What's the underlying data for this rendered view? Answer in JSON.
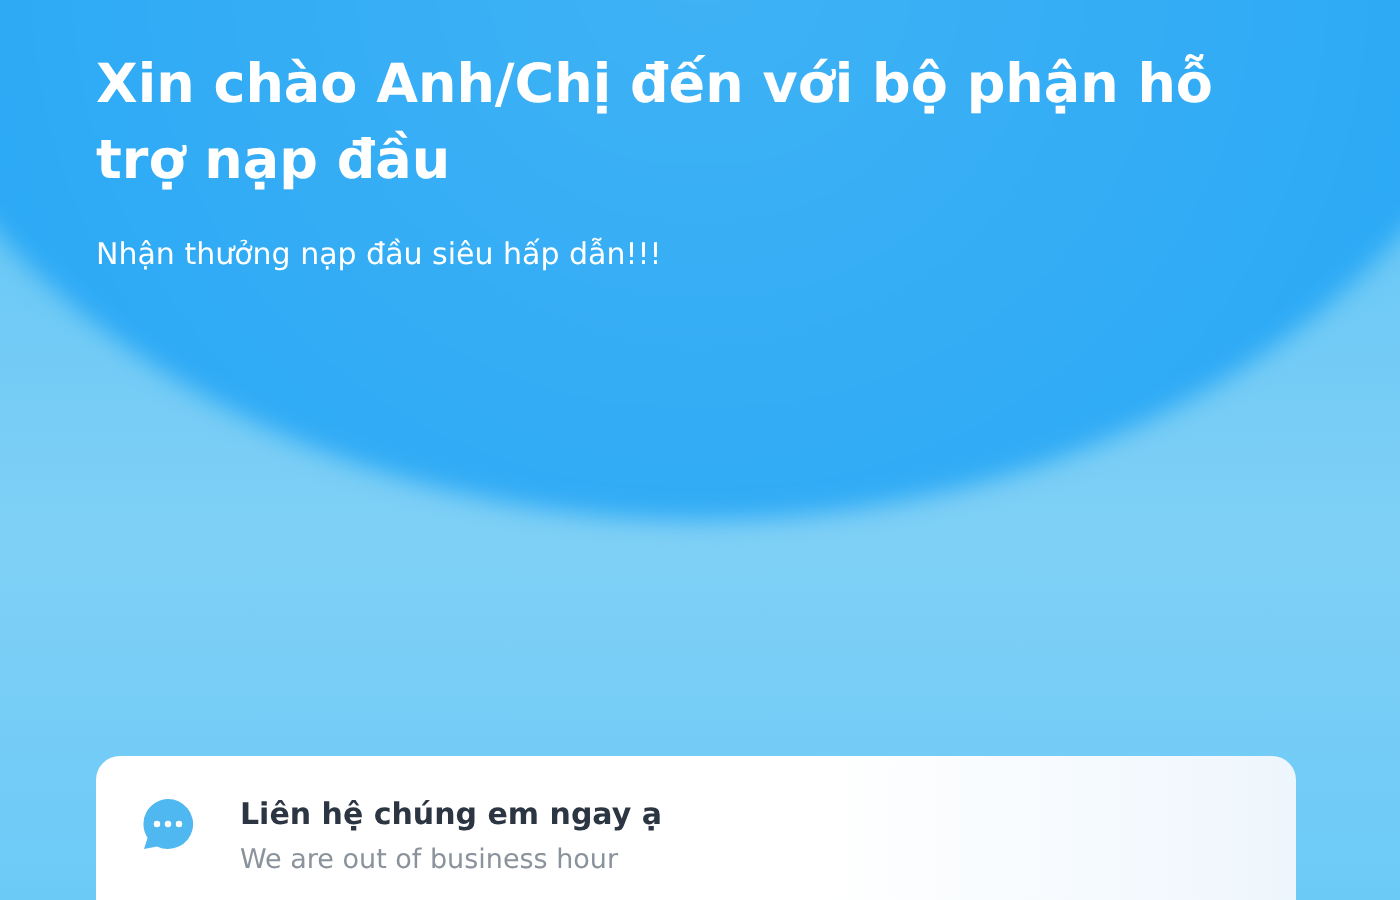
{
  "header": {
    "title": "Xin chào Anh/Chị đến với bộ phận hỗ trợ nạp đầu",
    "subtitle": "Nhận thưởng nạp đầu siêu hấp dẫn!!!"
  },
  "contact_card": {
    "title": "Liên hệ chúng em ngay ạ",
    "status": "We are out of business hour"
  }
}
